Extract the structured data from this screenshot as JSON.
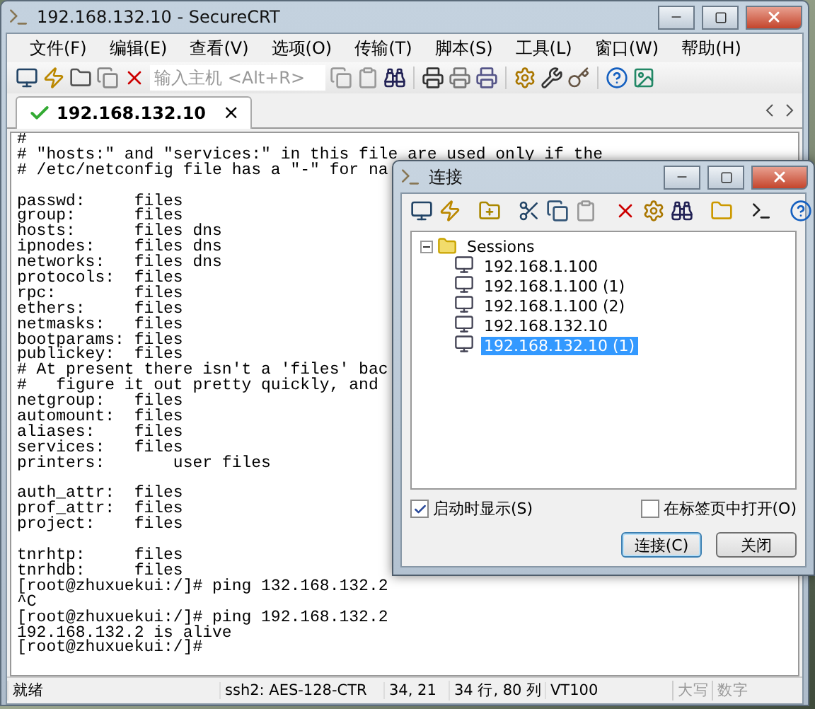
{
  "window": {
    "title": "192.168.132.10 - SecureCRT"
  },
  "menu": [
    "文件(F)",
    "编辑(E)",
    "查看(V)",
    "选项(O)",
    "传输(T)",
    "脚本(S)",
    "工具(L)",
    "窗口(W)",
    "帮助(H)"
  ],
  "toolbar": {
    "host_field": {
      "placeholder": "输入主机 <Alt+R>"
    }
  },
  "tabs": [
    {
      "label": "192.168.132.10",
      "selected": true,
      "connected": true,
      "close": "×"
    }
  ],
  "terminal": {
    "blocks": [
      [
        "#",
        "# \"hosts:\" and \"services:\" in this file are used only if the",
        "# /etc/netconfig file has a \"-\" for na"
      ],
      [
        "passwd:     files",
        "group:      files",
        "hosts:      files dns",
        "ipnodes:    files dns",
        "networks:   files dns",
        "protocols:  files",
        "rpc:        files",
        "ethers:     files",
        "netmasks:   files",
        "bootparams: files",
        "publickey:  files",
        "# At present there isn't a 'files' bac",
        "#   figure it out pretty quickly, and",
        "netgroup:   files",
        "automount:  files",
        "aliases:    files",
        "services:   files",
        "printers:       user files"
      ],
      [
        "auth_attr:  files",
        "prof_attr:  files",
        "project:    files"
      ],
      [
        "tnrhtp:     files",
        "tnrhdb:     files",
        "[root@zhuxuekui:/]# ping 132.168.132.2",
        "^C",
        "[root@zhuxuekui:/]# ping 192.168.132.2",
        "192.168.132.2 is alive",
        "[root@zhuxuekui:/]#"
      ]
    ]
  },
  "status_bar": [
    {
      "text": "就绪",
      "kind": "text"
    },
    {
      "text": "ssh2: AES-128-CTR",
      "kind": "text"
    },
    {
      "text": "34,  21",
      "kind": "text"
    },
    {
      "text": "34 行, 80 列",
      "kind": "text"
    },
    {
      "text": "VT100",
      "kind": "text"
    },
    {
      "text": "大写",
      "kind": "indicator",
      "on": false
    },
    {
      "text": "数字",
      "kind": "indicator",
      "on": false
    }
  ],
  "dialog": {
    "title": "连接",
    "tree": {
      "label": "Sessions",
      "expanded": true,
      "children": [
        {
          "label": "192.168.1.100",
          "selected": false
        },
        {
          "label": "192.168.1.100 (1)",
          "selected": false
        },
        {
          "label": "192.168.1.100 (2)",
          "selected": false
        },
        {
          "label": "192.168.132.10",
          "selected": false
        },
        {
          "label": "192.168.132.10 (1)",
          "selected": true
        }
      ]
    },
    "options": [
      {
        "label": "启动时显示(S)",
        "checked": true
      },
      {
        "label": "在标签页中打开(O)",
        "checked": false
      }
    ],
    "buttons": [
      {
        "label": "连接(C)",
        "default": true
      },
      {
        "label": "关闭",
        "default": false
      }
    ]
  }
}
